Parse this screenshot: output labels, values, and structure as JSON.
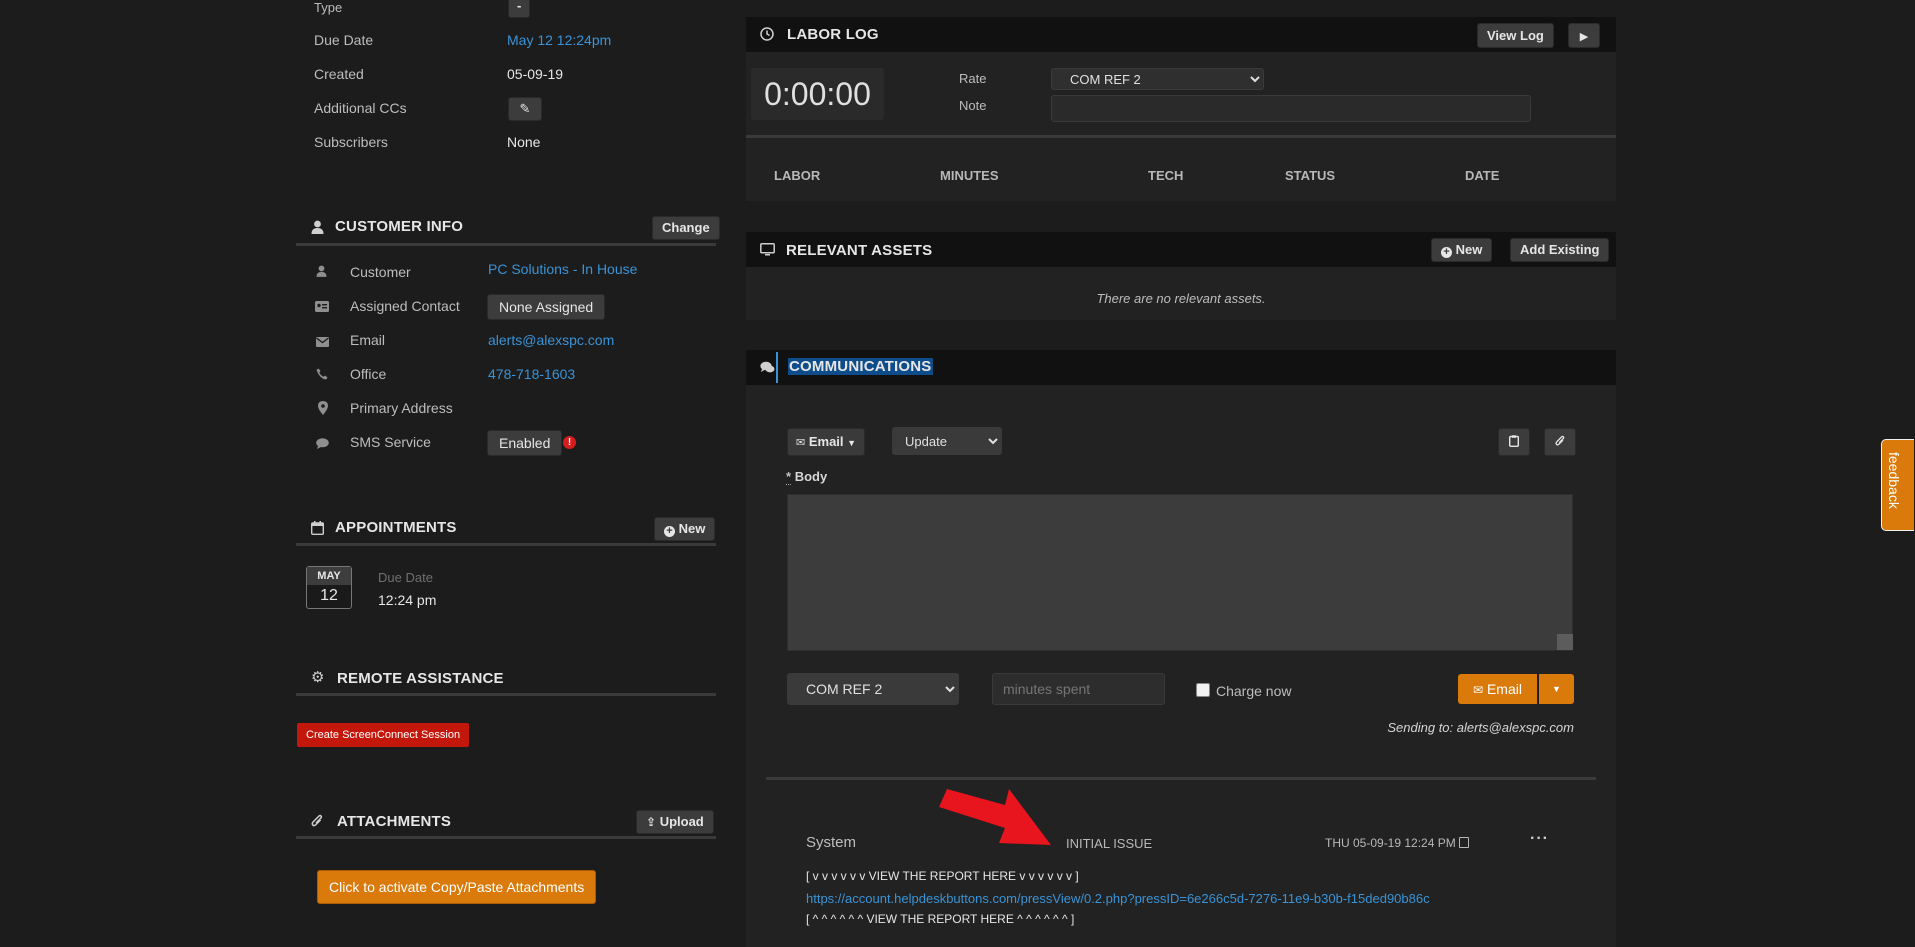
{
  "ticket": {
    "type_label": "Type",
    "type_value": "-",
    "due_date_label": "Due Date",
    "due_date_value": "May 12 12:24pm",
    "created_label": "Created",
    "created_value": "05-09-19",
    "additional_ccs_label": "Additional CCs",
    "subscribers_label": "Subscribers",
    "subscribers_value": "None"
  },
  "customer_info": {
    "title": "CUSTOMER INFO",
    "change_label": "Change",
    "rows": {
      "customer_label": "Customer",
      "customer_value": "PC Solutions - In House",
      "assigned_contact_label": "Assigned Contact",
      "assigned_contact_value": "None Assigned",
      "email_label": "Email",
      "email_value": "alerts@alexspc.com",
      "office_label": "Office",
      "office_value": "478-718-1603",
      "primary_address_label": "Primary Address",
      "sms_label": "SMS Service",
      "sms_value": "Enabled"
    }
  },
  "appointments": {
    "title": "APPOINTMENTS",
    "new_label": "New",
    "month": "MAY",
    "day": "12",
    "due_label": "Due Date",
    "time": "12:24 pm"
  },
  "remote_assistance": {
    "title": "REMOTE ASSISTANCE",
    "button_label": "Create ScreenConnect Session"
  },
  "attachments": {
    "title": "ATTACHMENTS",
    "upload_label": "Upload",
    "activate_label": "Click to activate Copy/Paste Attachments"
  },
  "labor_log": {
    "title": "LABOR LOG",
    "view_log_label": "View Log",
    "timer": "0:00:00",
    "rate_label": "Rate",
    "rate_value": "COM REF 2",
    "note_label": "Note",
    "columns": [
      "LABOR",
      "MINUTES",
      "TECH",
      "STATUS",
      "DATE"
    ]
  },
  "relevant_assets": {
    "title": "RELEVANT ASSETS",
    "new_label": "New",
    "add_existing_label": "Add Existing",
    "empty_text": "There are no relevant assets."
  },
  "communications": {
    "title": "COMMUNICATIONS",
    "email_dropdown_label": "Email",
    "update_value": "Update",
    "body_label": "Body",
    "rate_value": "COM REF 2",
    "minutes_placeholder": "minutes spent",
    "charge_now_label": "Charge now",
    "send_label": "Email",
    "sending_to": "Sending to: alerts@alexspc.com"
  },
  "log_entry": {
    "author": "System",
    "type": "INITIAL ISSUE",
    "timestamp": "THU 05-09-19 12:24 PM",
    "line1": "[ v v v v v v VIEW THE REPORT HERE v v v v v v ]",
    "link": "https://account.helpdeskbuttons.com/pressView/0.2.php?pressID=6e266c5d-7276-11e9-b30b-f15ded90b86c",
    "line3": "[ ^ ^ ^ ^ ^ ^ VIEW THE REPORT HERE ^ ^ ^ ^ ^ ^ ]"
  },
  "feedback_tab": "feedback",
  "colors": {
    "background": "#1c1c1c",
    "link": "#3a93d6",
    "accent_orange": "#d97a0b",
    "danger_red": "#c4170c",
    "arrow_red": "#e8141e"
  },
  "icons": [
    "user-icon",
    "id-card-icon",
    "envelope-icon",
    "phone-icon",
    "map-pin-icon",
    "comment-icon",
    "calendar-icon",
    "gear-icon",
    "paperclip-icon",
    "upload-icon",
    "clock-icon",
    "play-icon",
    "monitor-icon",
    "plus-circle-icon",
    "comments-icon",
    "clipboard-icon",
    "caret-down-icon",
    "note-icon",
    "ellipsis-icon",
    "pencil-icon",
    "alert-icon"
  ]
}
